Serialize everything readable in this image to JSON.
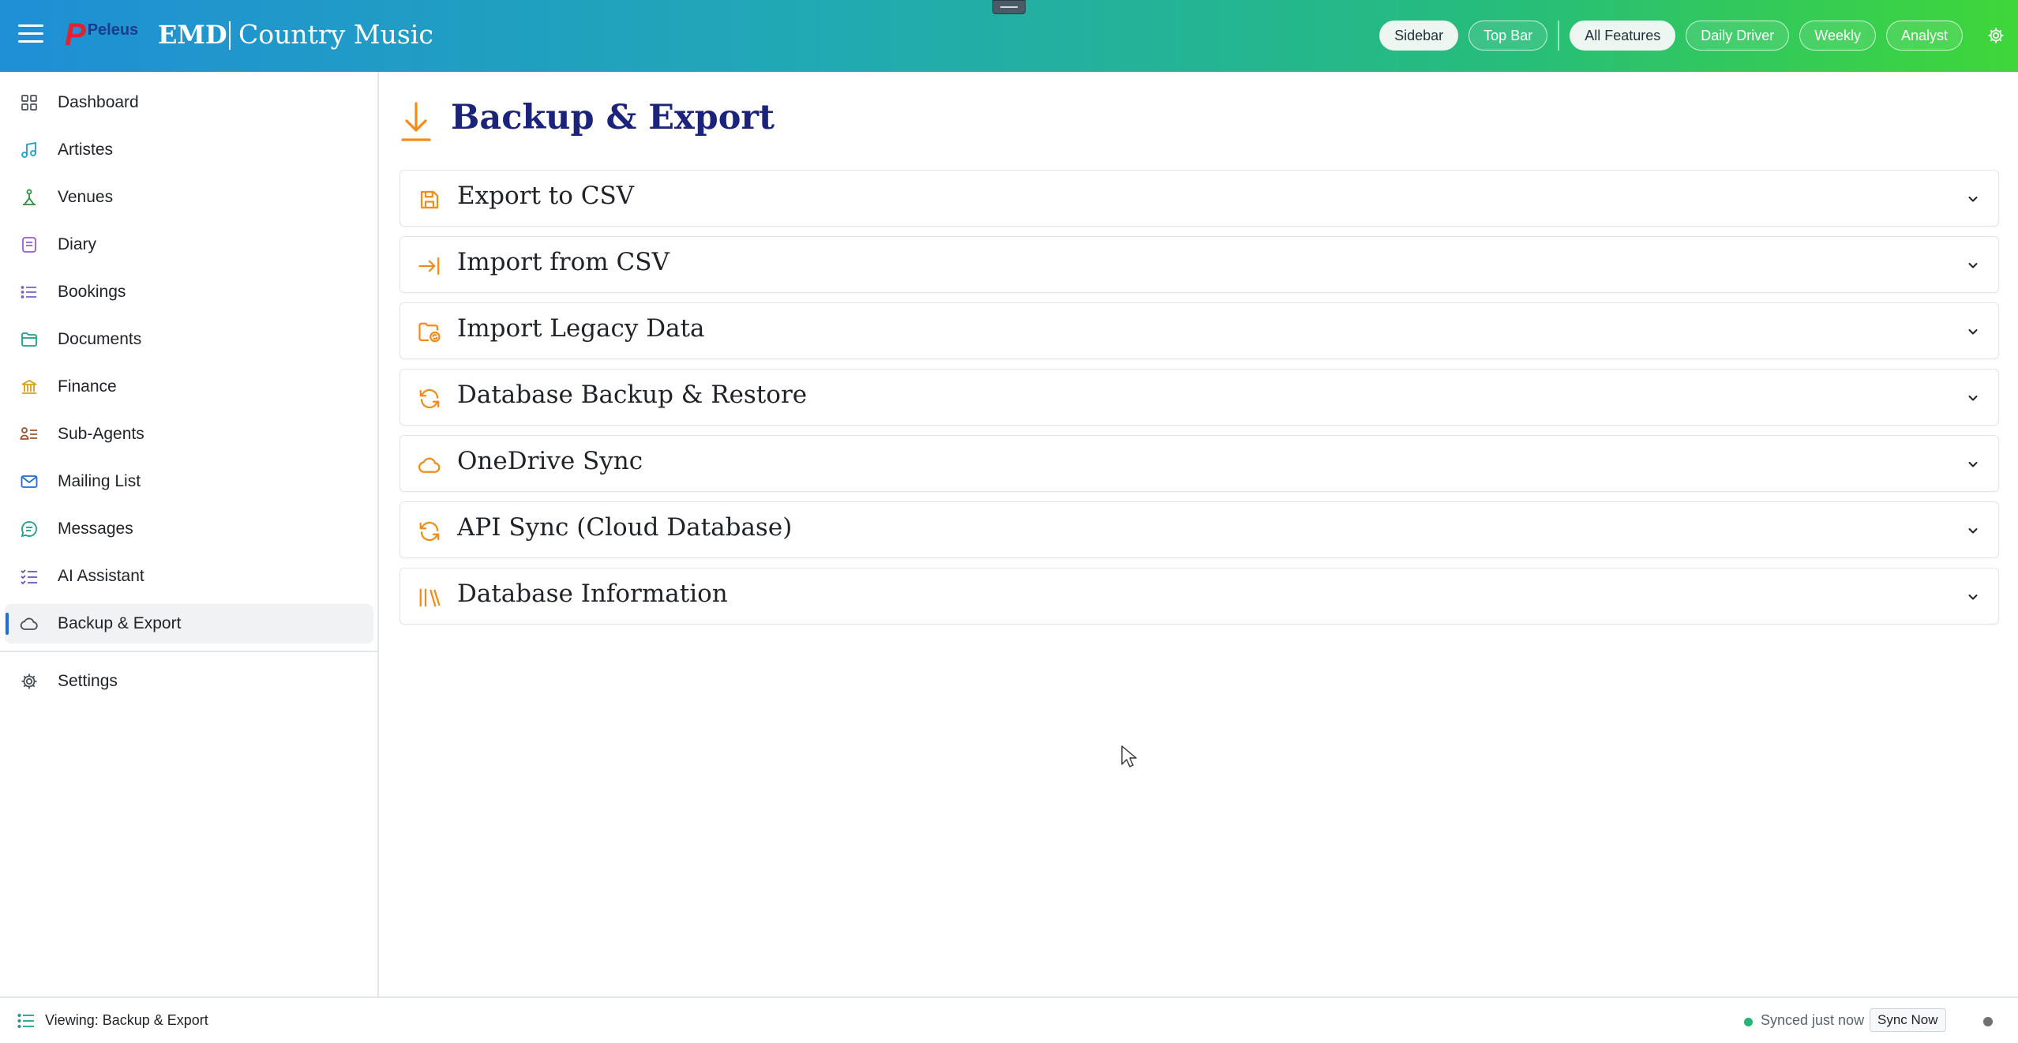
{
  "topbar": {
    "logo_text": "Peleus",
    "app_short": "EMD",
    "app_name": "Country Music",
    "layout_pills": [
      {
        "label": "Sidebar",
        "active": true
      },
      {
        "label": "Top Bar",
        "active": false
      }
    ],
    "mode_pills": [
      {
        "label": "All Features",
        "active": true
      },
      {
        "label": "Daily Driver",
        "active": false
      },
      {
        "label": "Weekly",
        "active": false
      },
      {
        "label": "Analyst",
        "active": false
      }
    ],
    "settings_icon": "gear-icon"
  },
  "sidebar": {
    "items": [
      {
        "label": "Dashboard",
        "icon": "grid-icon",
        "color": "#4a5058"
      },
      {
        "label": "Artistes",
        "icon": "music-note-icon",
        "color": "#1d9fd0"
      },
      {
        "label": "Venues",
        "icon": "venue-icon",
        "color": "#2e8b3a"
      },
      {
        "label": "Diary",
        "icon": "diary-icon",
        "color": "#9b59d0"
      },
      {
        "label": "Bookings",
        "icon": "list-icon",
        "color": "#7b5fc9"
      },
      {
        "label": "Documents",
        "icon": "folder-icon",
        "color": "#1e9e8a"
      },
      {
        "label": "Finance",
        "icon": "bank-icon",
        "color": "#d4a017"
      },
      {
        "label": "Sub-Agents",
        "icon": "users-list-icon",
        "color": "#a0522d"
      },
      {
        "label": "Mailing List",
        "icon": "mail-icon",
        "color": "#1f6fd1"
      },
      {
        "label": "Messages",
        "icon": "message-icon",
        "color": "#1e9e8a"
      },
      {
        "label": "AI Assistant",
        "icon": "checklist-icon",
        "color": "#6c4fc2"
      },
      {
        "label": "Backup & Export",
        "icon": "cloud-icon",
        "color": "#4a5058",
        "active": true
      }
    ],
    "settings": {
      "label": "Settings",
      "icon": "gear-icon",
      "color": "#4a5058"
    }
  },
  "main": {
    "title": "Backup & Export",
    "title_icon": "download-arrow-icon",
    "accent": "#f28c18",
    "panels": [
      {
        "label": "Export to CSV",
        "icon": "save-icon"
      },
      {
        "label": "Import from CSV",
        "icon": "import-arrow-icon"
      },
      {
        "label": "Import Legacy Data",
        "icon": "folder-sync-icon"
      },
      {
        "label": "Database Backup & Restore",
        "icon": "refresh-icon"
      },
      {
        "label": "OneDrive Sync",
        "icon": "cloud-icon"
      },
      {
        "label": "API Sync (Cloud Database)",
        "icon": "refresh-icon"
      },
      {
        "label": "Database Information",
        "icon": "library-icon"
      }
    ]
  },
  "statusbar": {
    "viewing": "Viewing: Backup & Export",
    "sync_status": "Synced just now",
    "sync_button": "Sync Now",
    "sync_color": "#22b573"
  }
}
